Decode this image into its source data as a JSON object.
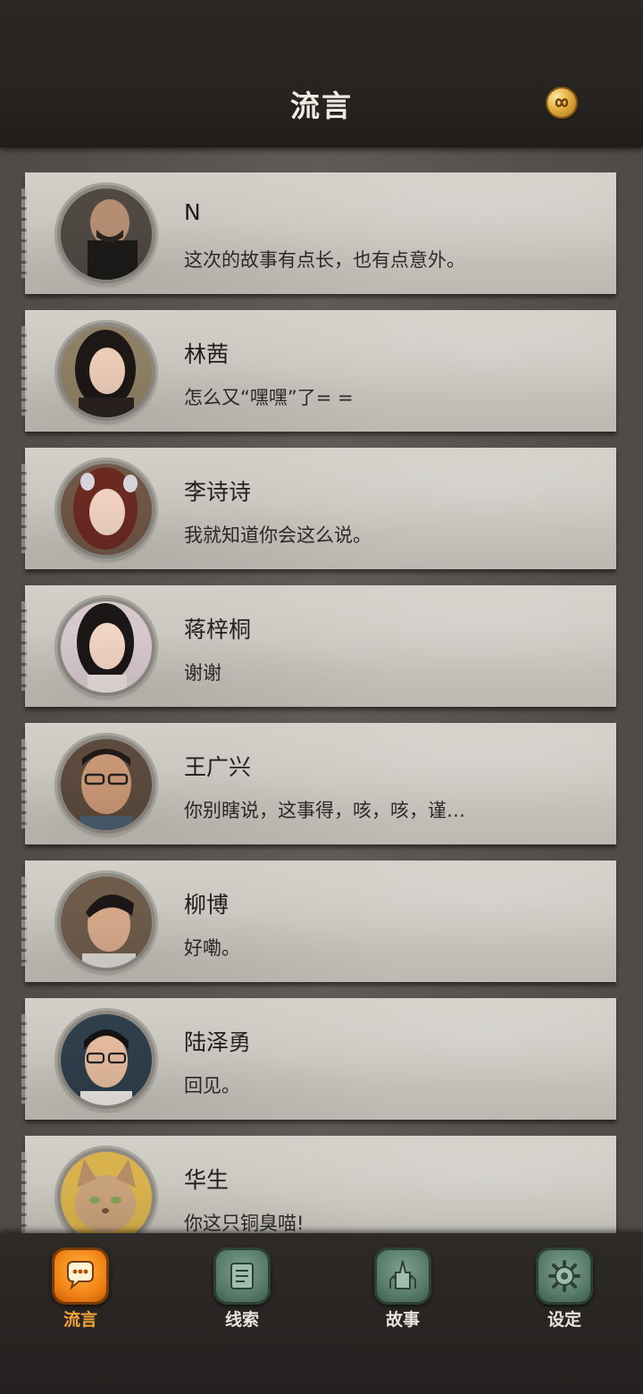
{
  "header": {
    "title": "流言",
    "coin_icon": "infinity-coin-icon"
  },
  "contacts": [
    {
      "name": "N",
      "message": "这次的故事有点长，也有点意外。",
      "avatar_tone": "#4a4440"
    },
    {
      "name": "林茜",
      "message": "怎么又“嘿嘿”了= =",
      "avatar_tone": "#3a2e2a"
    },
    {
      "name": "李诗诗",
      "message": "我就知道你会这么说。",
      "avatar_tone": "#5a2e26"
    },
    {
      "name": "蒋梓桐",
      "message": "谢谢",
      "avatar_tone": "#2c2422"
    },
    {
      "name": "王广兴",
      "message": "你别瞎说，这事得，咳，咳，谨…",
      "avatar_tone": "#3d3027"
    },
    {
      "name": "柳博",
      "message": "好嘞。",
      "avatar_tone": "#1e1b1a"
    },
    {
      "name": "陆泽勇",
      "message": "回见。",
      "avatar_tone": "#1c1a1a"
    },
    {
      "name": "华生",
      "message": "你这只铜臭喵!",
      "avatar_tone": "#b08a5e"
    }
  ],
  "tabs": [
    {
      "label": "流言",
      "icon": "chat-bubble-icon",
      "active": true
    },
    {
      "label": "线索",
      "icon": "scroll-icon",
      "active": false
    },
    {
      "label": "故事",
      "icon": "tower-icon",
      "active": false
    },
    {
      "label": "设定",
      "icon": "gear-icon",
      "active": false
    }
  ],
  "colors": {
    "accent": "#f08a1a",
    "tab_idle": "#557868",
    "card": "#c9c6bf",
    "header_bg": "#272422"
  }
}
